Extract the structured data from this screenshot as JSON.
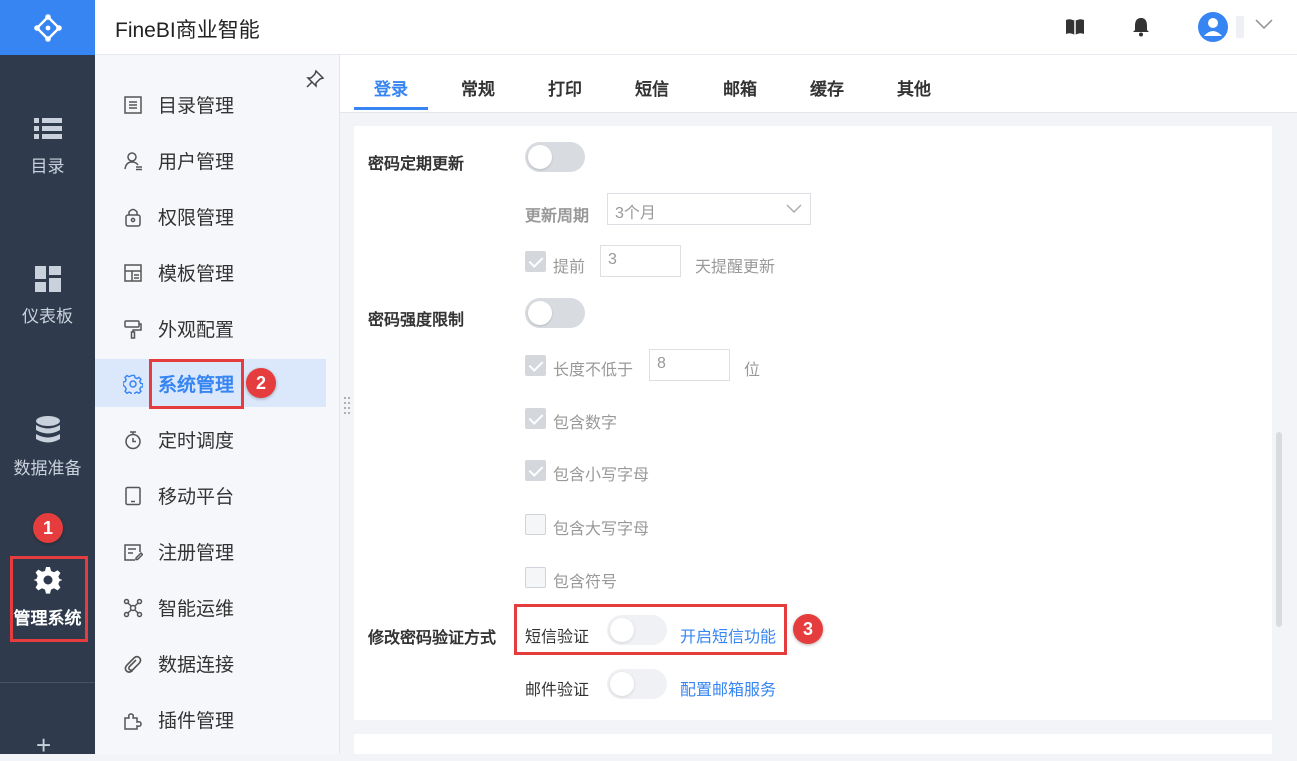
{
  "app": {
    "title": "FineBI商业智能"
  },
  "leftnav": {
    "items": [
      {
        "label": "目录",
        "icon": "list-icon"
      },
      {
        "label": "仪表板",
        "icon": "dashboard-icon"
      },
      {
        "label": "数据准备",
        "icon": "database-icon"
      },
      {
        "label": "管理系统",
        "icon": "gear-icon",
        "active": true
      }
    ]
  },
  "submenu": {
    "items": [
      {
        "label": "目录管理",
        "icon": "catalog-icon"
      },
      {
        "label": "用户管理",
        "icon": "user-icon"
      },
      {
        "label": "权限管理",
        "icon": "lock-icon"
      },
      {
        "label": "模板管理",
        "icon": "template-icon"
      },
      {
        "label": "外观配置",
        "icon": "paint-roller-icon"
      },
      {
        "label": "系统管理",
        "icon": "gear-icon",
        "active": true
      },
      {
        "label": "定时调度",
        "icon": "stopwatch-icon"
      },
      {
        "label": "移动平台",
        "icon": "tablet-icon"
      },
      {
        "label": "注册管理",
        "icon": "register-icon"
      },
      {
        "label": "智能运维",
        "icon": "network-icon"
      },
      {
        "label": "数据连接",
        "icon": "link-icon"
      },
      {
        "label": "插件管理",
        "icon": "plugin-icon"
      }
    ]
  },
  "tabs": [
    "登录",
    "常规",
    "打印",
    "短信",
    "邮箱",
    "缓存",
    "其他"
  ],
  "active_tab": "登录",
  "settings": {
    "pwd_expire": {
      "label": "密码定期更新",
      "enabled": false
    },
    "update_cycle": {
      "label": "更新周期",
      "value": "3个月"
    },
    "advance": {
      "label": "提前",
      "value": "3",
      "suffix": "天提醒更新",
      "checked": true
    },
    "pwd_strength": {
      "label": "密码强度限制",
      "enabled": false
    },
    "min_length": {
      "label": "长度不低于",
      "value": "8",
      "suffix": "位",
      "checked": true
    },
    "digits": {
      "label": "包含数字",
      "checked": true
    },
    "lower": {
      "label": "包含小写字母",
      "checked": true
    },
    "upper": {
      "label": "包含大写字母",
      "checked": false
    },
    "symbol": {
      "label": "包含符号",
      "checked": false
    },
    "verify": {
      "label": "修改密码验证方式",
      "sms": {
        "label": "短信验证",
        "enabled": false,
        "link": "开启短信功能"
      },
      "email": {
        "label": "邮件验证",
        "enabled": false,
        "link": "配置邮箱服务"
      }
    }
  },
  "annotations": [
    "1",
    "2",
    "3"
  ],
  "colors": {
    "accent": "#3685f2",
    "nav_bg": "#2f3b4c",
    "annotation": "#e53d3d"
  }
}
